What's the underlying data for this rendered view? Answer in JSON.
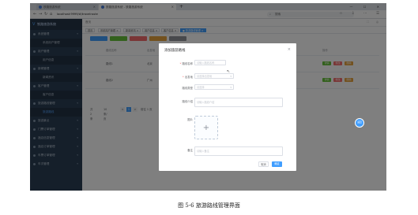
{
  "browser": {
    "tabs": [
      {
        "label": "铁路旅游系统"
      },
      {
        "label": "铁路旅游系统 - 铁路旅游系统"
      }
    ],
    "new_tab": "+",
    "window_controls": "— ☐ ✕",
    "nav": {
      "back": "←",
      "forward": "→",
      "reload": "↻",
      "home": "⌂"
    },
    "url": "localhost:9999/#/travelroute",
    "search_placeholder": "搜索",
    "search_icon": "search-icon",
    "addr_icons": "☆ ⇩ ⋯ ☰"
  },
  "sidebar": {
    "brand": "铁路旅游系统",
    "items": [
      {
        "label": "系统管理",
        "caret": "▾",
        "sub": false,
        "active": false
      },
      {
        "label": "系统用户管理",
        "caret": "",
        "sub": true,
        "active": false
      },
      {
        "label": "用户管理",
        "caret": "▾",
        "sub": false,
        "active": false
      },
      {
        "label": "用户信息",
        "caret": "",
        "sub": true,
        "active": false
      },
      {
        "label": "新闻管理",
        "caret": "▾",
        "sub": false,
        "active": false
      },
      {
        "label": "新闻资讯",
        "caret": "",
        "sub": true,
        "active": false
      },
      {
        "label": "客户管理",
        "caret": "▾",
        "sub": false,
        "active": false
      },
      {
        "label": "客户信息",
        "caret": "",
        "sub": true,
        "active": false
      },
      {
        "label": "旅游路线管理",
        "caret": "▾",
        "sub": false,
        "active": false
      },
      {
        "label": "旅游路线",
        "caret": "",
        "sub": true,
        "active": true
      },
      {
        "label": "旅游景点",
        "caret": "▾",
        "sub": false,
        "active": false
      },
      {
        "label": "门票订单管理",
        "caret": "▾",
        "sub": false,
        "active": false
      },
      {
        "label": "酒店信息管理",
        "caret": "▾",
        "sub": false,
        "active": false
      },
      {
        "label": "酒店订单管理",
        "caret": "▾",
        "sub": false,
        "active": false
      },
      {
        "label": "车票订单管理",
        "caret": "▾",
        "sub": false,
        "active": false
      },
      {
        "label": "车次管理",
        "caret": "▾",
        "sub": false,
        "active": false
      }
    ]
  },
  "header": {
    "breadcrumb": "首页",
    "right_icons": "⛶ ◎"
  },
  "tags": [
    {
      "label": "首页",
      "active": false
    },
    {
      "label": "系统用户管理 ×",
      "active": false
    },
    {
      "label": "新闻资讯 ×",
      "active": false
    },
    {
      "label": "用户信息 ×",
      "active": false
    },
    {
      "label": "客户信息 ×",
      "active": false
    },
    {
      "label": "● 旅游路线管理 ×",
      "active": true
    }
  ],
  "toolbar": {
    "colors": [
      "#409eff",
      "#67c23a",
      "#f56c6c",
      "#e6a23c",
      "#909399"
    ]
  },
  "table": {
    "headers": [
      "",
      "路线名称",
      "出发地",
      "目的地",
      "路线天数",
      "创建时间",
      "操作"
    ],
    "rows": [
      [
        "",
        "路线1",
        "北京",
        "上海",
        "3",
        "2024-04-11 10:05",
        ""
      ],
      [
        "",
        "路线2",
        "广州",
        "三亚",
        "5",
        "2024-04-11 10:08",
        ""
      ]
    ],
    "op_labels": [
      "详情",
      "修改",
      "删除"
    ],
    "op_colors": [
      "#67c23a",
      "#f56c6c",
      "#e6a23c"
    ]
  },
  "pagination": {
    "total": "共 2 条",
    "page_size": "10条/页",
    "prev": "<",
    "page": "1",
    "next": ">",
    "goto": "前往 1 页"
  },
  "dialog": {
    "title": "添加旅游路线",
    "close": "×",
    "fields": [
      {
        "label": "路线名称",
        "required": true,
        "placeholder": "请输入路线名称",
        "type": "input",
        "caret": ""
      },
      {
        "label": "出发地",
        "required": true,
        "placeholder": "请选择出发地",
        "type": "select",
        "caret": "▾"
      },
      {
        "label": "路线类型",
        "required": false,
        "placeholder": "请选择",
        "type": "select",
        "caret": "▾"
      },
      {
        "label": "路线介绍",
        "required": false,
        "placeholder": "请输入路线介绍",
        "type": "textarea",
        "caret": ""
      },
      {
        "label": "图片",
        "required": false,
        "placeholder": "+",
        "type": "upload",
        "caret": ""
      },
      {
        "label": "备注",
        "required": false,
        "placeholder": "请输入备注",
        "type": "textarea",
        "caret": ""
      }
    ],
    "cancel_label": "取消",
    "ok_label": "确定"
  },
  "float_button": "返回",
  "caption": "图 5-6 旅游路线管理界面"
}
